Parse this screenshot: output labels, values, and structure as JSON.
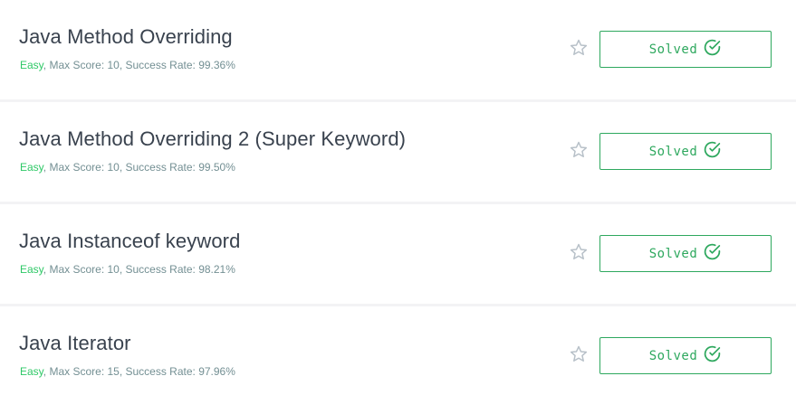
{
  "challenges": [
    {
      "title": "Java Method Overriding",
      "difficulty": "Easy",
      "details": ", Max Score: 10, Success Rate: 99.36%",
      "status_label": "Solved"
    },
    {
      "title": "Java Method Overriding 2 (Super Keyword)",
      "difficulty": "Easy",
      "details": ", Max Score: 10, Success Rate: 99.50%",
      "status_label": "Solved"
    },
    {
      "title": "Java Instanceof keyword",
      "difficulty": "Easy",
      "details": ", Max Score: 10, Success Rate: 98.21%",
      "status_label": "Solved"
    },
    {
      "title": "Java Iterator",
      "difficulty": "Easy",
      "details": ", Max Score: 15, Success Rate: 97.96%",
      "status_label": "Solved"
    }
  ],
  "icons": {
    "star": "star-outline-icon",
    "check": "check-circle-icon"
  },
  "colors": {
    "easy": "#2ec866",
    "solved": "#2ea85e",
    "title": "#39424e",
    "meta": "#738f93",
    "star": "#b7c0c8"
  }
}
